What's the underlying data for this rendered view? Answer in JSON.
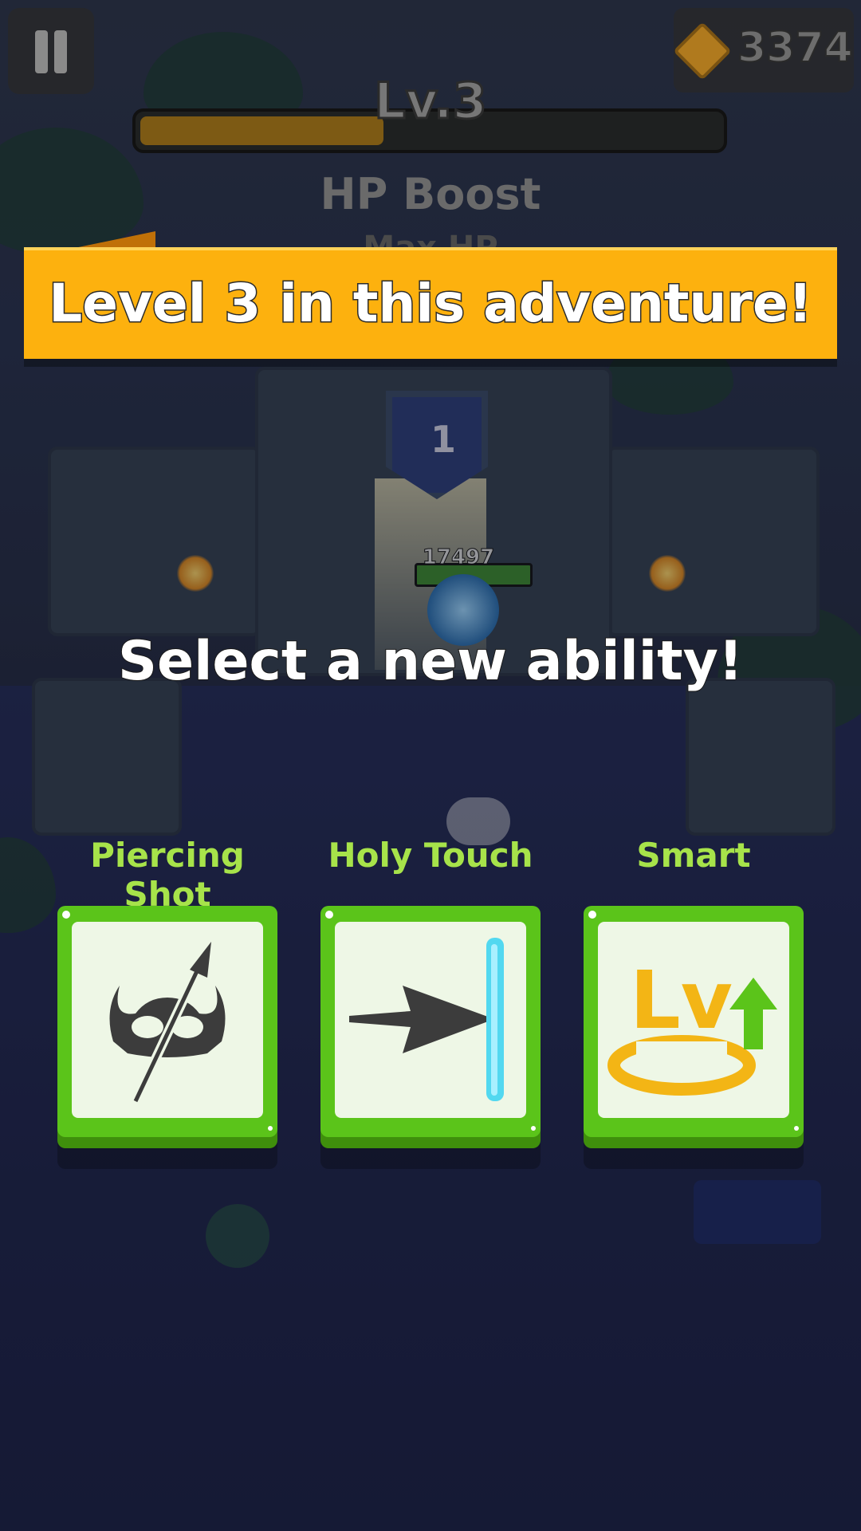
{
  "hud": {
    "pause_label": "Pause",
    "gem_count": "3374",
    "level": "Lv.3",
    "xp_progress": 0.42,
    "last_pick_title": "HP Boost",
    "last_pick_subtitle": "Max HP increased!"
  },
  "banner": {
    "text": "Level 3 in this adventure!"
  },
  "room": {
    "room_number": "1",
    "player_hp": "17497"
  },
  "prompt": "Select a new ability!",
  "abilities": [
    {
      "name": "Piercing Shot",
      "icon": "helmet-pierce-icon"
    },
    {
      "name": "Holy Touch",
      "icon": "arrow-wall-icon"
    },
    {
      "name": "Smart",
      "icon": "level-up-icon",
      "icon_text": "Lv"
    }
  ],
  "colors": {
    "banner": "#fdb10e",
    "card": "#5bc41a",
    "ability_name": "#a7e34a"
  }
}
